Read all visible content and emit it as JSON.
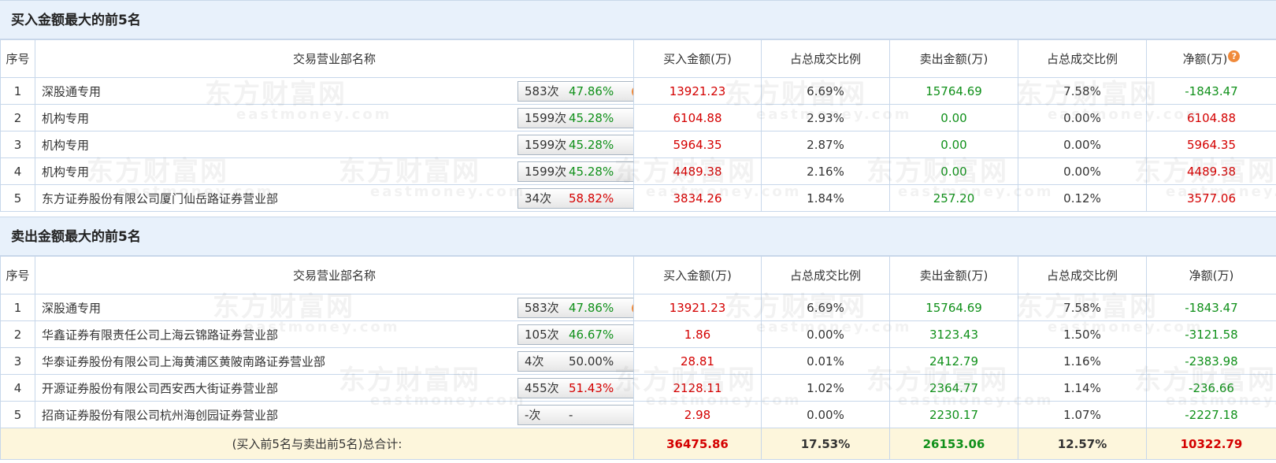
{
  "buy_section": {
    "title": "买入金额最大的前5名",
    "headers": [
      "序号",
      "交易营业部名称",
      "买入金额(万)",
      "占总成交比例",
      "卖出金额(万)",
      "占总成交比例",
      "净额(万)"
    ],
    "rows": [
      {
        "idx": "1",
        "name": "深股通专用",
        "count": "583次",
        "pct": "47.86%",
        "pct_color": "green",
        "icon": "question-icon",
        "buy": "13921.23",
        "buy_pct": "6.69%",
        "sell": "15764.69",
        "sell_pct": "7.58%",
        "net": "-1843.47",
        "net_color": "green"
      },
      {
        "idx": "2",
        "name": "机构专用",
        "count": "1599次",
        "pct": "45.28%",
        "pct_color": "green",
        "icon": "arrow-right-icon",
        "buy": "6104.88",
        "buy_pct": "2.93%",
        "sell": "0.00",
        "sell_pct": "0.00%",
        "net": "6104.88",
        "net_color": "red"
      },
      {
        "idx": "3",
        "name": "机构专用",
        "count": "1599次",
        "pct": "45.28%",
        "pct_color": "green",
        "icon": "arrow-right-icon",
        "buy": "5964.35",
        "buy_pct": "2.87%",
        "sell": "0.00",
        "sell_pct": "0.00%",
        "net": "5964.35",
        "net_color": "red"
      },
      {
        "idx": "4",
        "name": "机构专用",
        "count": "1599次",
        "pct": "45.28%",
        "pct_color": "green",
        "icon": "arrow-right-icon",
        "buy": "4489.38",
        "buy_pct": "2.16%",
        "sell": "0.00",
        "sell_pct": "0.00%",
        "net": "4489.38",
        "net_color": "red"
      },
      {
        "idx": "5",
        "name": "东方证券股份有限公司厦门仙岳路证券营业部",
        "count": "34次",
        "pct": "58.82%",
        "pct_color": "red",
        "icon": "arrow-right-icon",
        "buy": "3834.26",
        "buy_pct": "1.84%",
        "sell": "257.20",
        "sell_pct": "0.12%",
        "net": "3577.06",
        "net_color": "red"
      }
    ]
  },
  "sell_section": {
    "title": "卖出金额最大的前5名",
    "headers": [
      "序号",
      "交易营业部名称",
      "买入金额(万)",
      "占总成交比例",
      "卖出金额(万)",
      "占总成交比例",
      "净额(万)"
    ],
    "rows": [
      {
        "idx": "1",
        "name": "深股通专用",
        "count": "583次",
        "pct": "47.86%",
        "pct_color": "green",
        "icon": "question-icon",
        "buy": "13921.23",
        "buy_pct": "6.69%",
        "sell": "15764.69",
        "sell_pct": "7.58%",
        "net": "-1843.47",
        "net_color": "green"
      },
      {
        "idx": "2",
        "name": "华鑫证券有限责任公司上海云锦路证券营业部",
        "count": "105次",
        "pct": "46.67%",
        "pct_color": "green",
        "icon": "arrow-right-icon",
        "buy": "1.86",
        "buy_pct": "0.00%",
        "sell": "3123.43",
        "sell_pct": "1.50%",
        "net": "-3121.58",
        "net_color": "green"
      },
      {
        "idx": "3",
        "name": "华泰证券股份有限公司上海黄浦区黄陂南路证券营业部",
        "count": "4次",
        "pct": "50.00%",
        "pct_color": "dark",
        "icon": "arrow-right-icon",
        "buy": "28.81",
        "buy_pct": "0.01%",
        "sell": "2412.79",
        "sell_pct": "1.16%",
        "net": "-2383.98",
        "net_color": "green"
      },
      {
        "idx": "4",
        "name": "开源证券股份有限公司西安西大街证券营业部",
        "count": "455次",
        "pct": "51.43%",
        "pct_color": "red",
        "icon": "arrow-right-icon",
        "buy": "2128.11",
        "buy_pct": "1.02%",
        "sell": "2364.77",
        "sell_pct": "1.14%",
        "net": "-236.66",
        "net_color": "green"
      },
      {
        "idx": "5",
        "name": "招商证券股份有限公司杭州海创园证券营业部",
        "count": "-次",
        "pct": "-",
        "pct_color": "dark",
        "icon": "arrow-right-icon",
        "buy": "2.98",
        "buy_pct": "0.00%",
        "sell": "2230.17",
        "sell_pct": "1.07%",
        "net": "-2227.18",
        "net_color": "green"
      }
    ]
  },
  "total": {
    "label": "(买入前5名与卖出前5名)总合计:",
    "buy": "36475.86",
    "buy_pct": "17.53%",
    "sell": "26153.06",
    "sell_pct": "12.57%",
    "net": "10322.79"
  },
  "watermark": {
    "cn": "东方财富网",
    "en": "eastmoney.com"
  },
  "colors": {
    "red": "#d40000",
    "green": "#10901a",
    "header_bg": "#e8f1fb",
    "total_bg": "#fdf6dc",
    "border": "#c7d7ea"
  }
}
